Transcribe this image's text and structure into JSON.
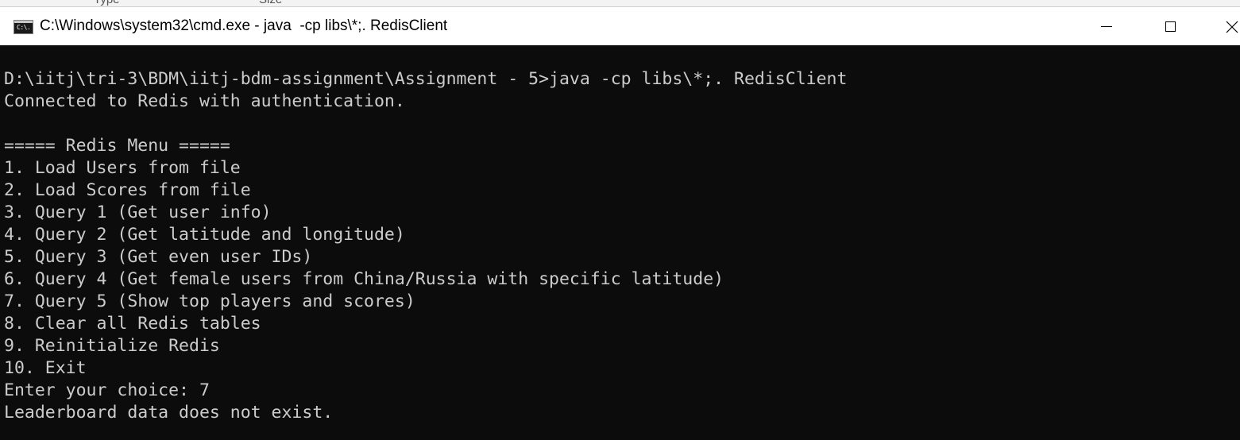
{
  "background_window": {
    "col_type": "Type",
    "col_size": "Size"
  },
  "window": {
    "icon_text": "C:\\.",
    "title": "C:\\Windows\\system32\\cmd.exe - java  -cp libs\\*;. RedisClient"
  },
  "console": {
    "lines": [
      "D:\\iitj\\tri-3\\BDM\\iitj-bdm-assignment\\Assignment - 5>java -cp libs\\*;. RedisClient",
      "Connected to Redis with authentication.",
      "",
      "===== Redis Menu =====",
      "1. Load Users from file",
      "2. Load Scores from file",
      "3. Query 1 (Get user info)",
      "4. Query 2 (Get latitude and longitude)",
      "5. Query 3 (Get even user IDs)",
      "6. Query 4 (Get female users from China/Russia with specific latitude)",
      "7. Query 5 (Show top players and scores)",
      "8. Clear all Redis tables",
      "9. Reinitialize Redis",
      "10. Exit",
      "Enter your choice: 7",
      "Leaderboard data does not exist."
    ]
  },
  "colors": {
    "console_bg": "#0c0c0c",
    "console_fg": "#cccccc",
    "titlebar_bg": "#ffffff"
  },
  "icons": [
    "cmd-app-icon",
    "minimize-icon",
    "maximize-icon",
    "close-icon"
  ]
}
